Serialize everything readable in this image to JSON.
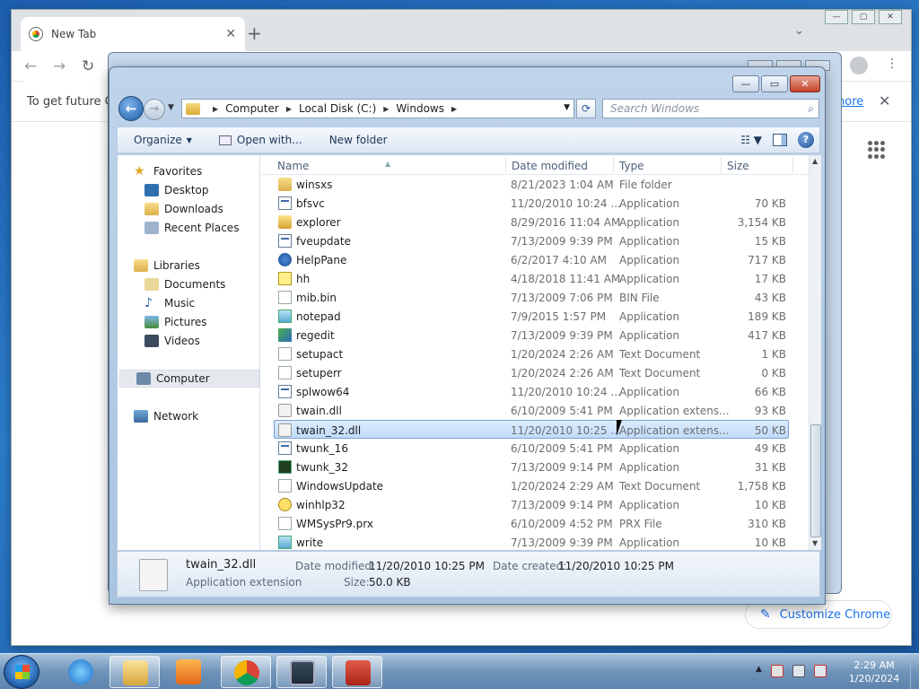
{
  "chrome": {
    "tab_title": "New Tab",
    "tab_close": "✕",
    "new_tab": "+",
    "tab_menu": "⌄",
    "win_min": "—",
    "win_max": "▢",
    "win_close": "✕",
    "back": "←",
    "forward": "→",
    "reload": "↻",
    "menu": "⋮",
    "infobar_text": "To get future Ge",
    "infobar_link": "hore",
    "infobar_close": "✕",
    "customize_label": "Customize Chrome",
    "customize_icon": "✎"
  },
  "explorer": {
    "title_buttons": {
      "min": "—",
      "max": "▭",
      "close": "✕"
    },
    "back_icon": "←",
    "forward_icon": "→",
    "path": [
      "Computer",
      "Local Disk (C:)",
      "Windows"
    ],
    "search_placeholder": "Search Windows",
    "toolbar": {
      "organize": "Organize",
      "open_with": "Open with...",
      "new_folder": "New folder"
    },
    "nav": {
      "favorites": "Favorites",
      "desktop": "Desktop",
      "downloads": "Downloads",
      "recent": "Recent Places",
      "libraries": "Libraries",
      "documents": "Documents",
      "music": "Music",
      "pictures": "Pictures",
      "videos": "Videos",
      "computer": "Computer",
      "network": "Network"
    },
    "columns": {
      "name": "Name",
      "date": "Date modified",
      "type": "Type",
      "size": "Size"
    },
    "files": [
      {
        "name": "winsxs",
        "date": "8/21/2023 1:04 AM",
        "type": "File folder",
        "size": "",
        "icon": "folder"
      },
      {
        "name": "bfsvc",
        "date": "11/20/2010 10:24 ...",
        "type": "Application",
        "size": "70 KB",
        "icon": "app"
      },
      {
        "name": "explorer",
        "date": "8/29/2016 11:04 AM",
        "type": "Application",
        "size": "3,154 KB",
        "icon": "explorer"
      },
      {
        "name": "fveupdate",
        "date": "7/13/2009 9:39 PM",
        "type": "Application",
        "size": "15 KB",
        "icon": "app"
      },
      {
        "name": "HelpPane",
        "date": "6/2/2017 4:10 AM",
        "type": "Application",
        "size": "717 KB",
        "icon": "help"
      },
      {
        "name": "hh",
        "date": "4/18/2018 11:41 AM",
        "type": "Application",
        "size": "17 KB",
        "icon": "hh"
      },
      {
        "name": "mib.bin",
        "date": "7/13/2009 7:06 PM",
        "type": "BIN File",
        "size": "43 KB",
        "icon": "txt"
      },
      {
        "name": "notepad",
        "date": "7/9/2015 1:57 PM",
        "type": "Application",
        "size": "189 KB",
        "icon": "note"
      },
      {
        "name": "regedit",
        "date": "7/13/2009 9:39 PM",
        "type": "Application",
        "size": "417 KB",
        "icon": "reg"
      },
      {
        "name": "setupact",
        "date": "1/20/2024 2:26 AM",
        "type": "Text Document",
        "size": "1 KB",
        "icon": "txt"
      },
      {
        "name": "setuperr",
        "date": "1/20/2024 2:26 AM",
        "type": "Text Document",
        "size": "0 KB",
        "icon": "txt"
      },
      {
        "name": "splwow64",
        "date": "11/20/2010 10:24 ...",
        "type": "Application",
        "size": "66 KB",
        "icon": "app"
      },
      {
        "name": "twain.dll",
        "date": "6/10/2009 5:41 PM",
        "type": "Application extens...",
        "size": "93 KB",
        "icon": "dll"
      },
      {
        "name": "twain_32.dll",
        "date": "11/20/2010 10:25 ...",
        "type": "Application extens...",
        "size": "50 KB",
        "icon": "dll",
        "selected": true
      },
      {
        "name": "twunk_16",
        "date": "6/10/2009 5:41 PM",
        "type": "Application",
        "size": "49 KB",
        "icon": "app"
      },
      {
        "name": "twunk_32",
        "date": "7/13/2009 9:14 PM",
        "type": "Application",
        "size": "31 KB",
        "icon": "green"
      },
      {
        "name": "WindowsUpdate",
        "date": "1/20/2024 2:29 AM",
        "type": "Text Document",
        "size": "1,758 KB",
        "icon": "txt"
      },
      {
        "name": "winhlp32",
        "date": "7/13/2009 9:14 PM",
        "type": "Application",
        "size": "10 KB",
        "icon": "q"
      },
      {
        "name": "WMSysPr9.prx",
        "date": "6/10/2009 4:52 PM",
        "type": "PRX File",
        "size": "310 KB",
        "icon": "txt"
      },
      {
        "name": "write",
        "date": "7/13/2009 9:39 PM",
        "type": "Application",
        "size": "10 KB",
        "icon": "note"
      }
    ],
    "details": {
      "name": "twain_32.dll",
      "type": "Application extension",
      "modified_label": "Date modified:",
      "modified": "11/20/2010 10:25 PM",
      "created_label": "Date created:",
      "created": "11/20/2010 10:25 PM",
      "size_label": "Size:",
      "size": "50.0 KB"
    }
  },
  "taskbar": {
    "time": "2:29 AM",
    "date": "1/20/2024",
    "tray_arrow": "▲"
  }
}
